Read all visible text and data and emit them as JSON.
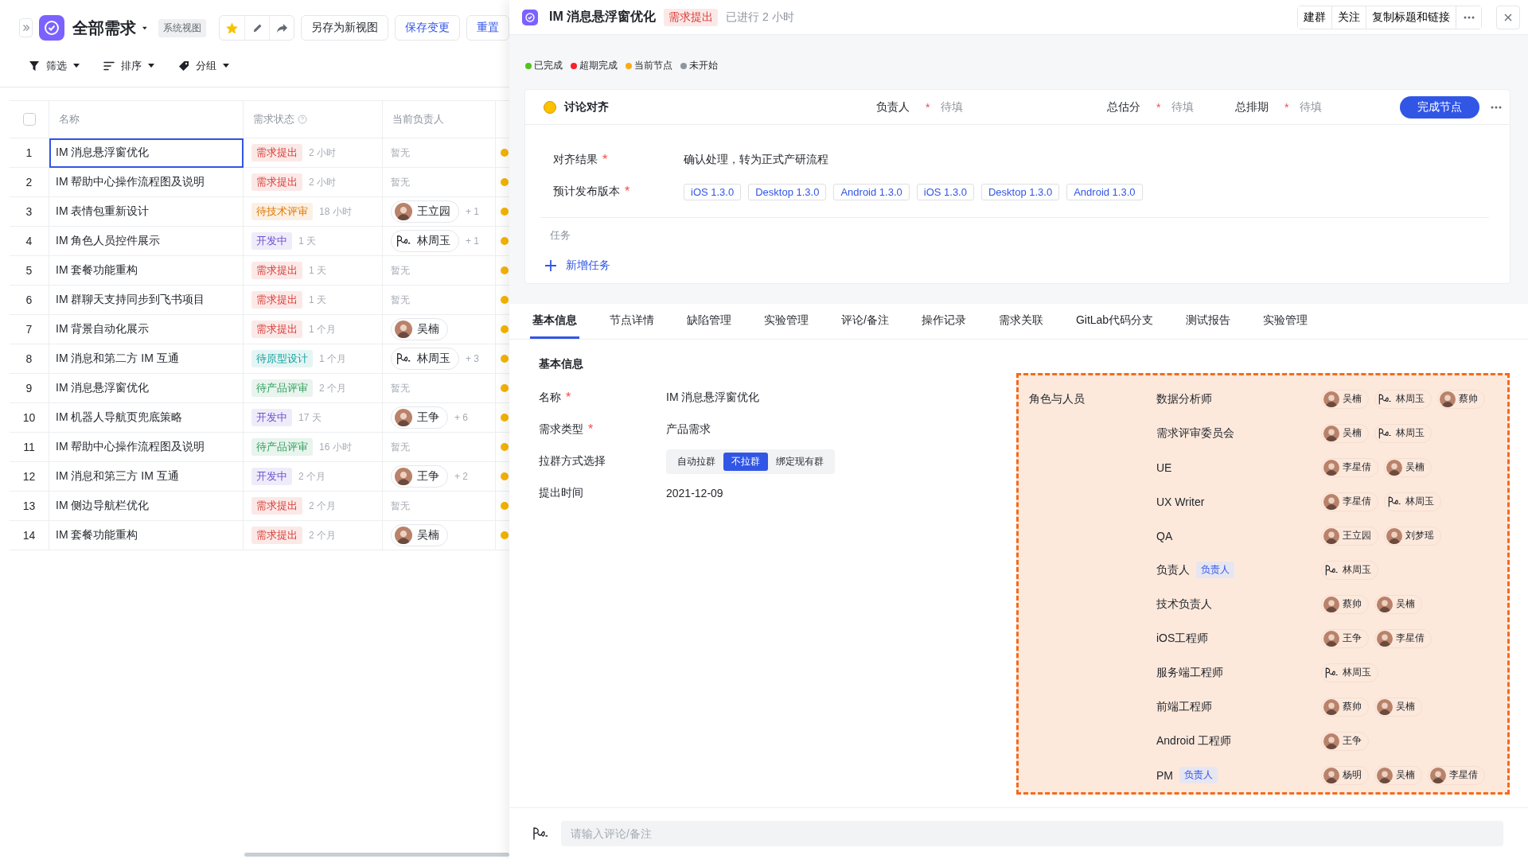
{
  "view": {
    "title": "全部需求",
    "badge": "系统视图",
    "starred": true,
    "actions": [
      {
        "label": "另存为新视图",
        "primary": false
      },
      {
        "label": "保存变更",
        "primary": true
      },
      {
        "label": "重置",
        "primary": true
      }
    ]
  },
  "toolbar": [
    {
      "kind": "filter",
      "label": "筛选"
    },
    {
      "kind": "sort",
      "label": "排序"
    },
    {
      "kind": "group",
      "label": "分组"
    }
  ],
  "table": {
    "select_all_checked": false,
    "columns": [
      "名称",
      "需求状态",
      "当前负责人"
    ],
    "rows": [
      {
        "index": "1",
        "name": "IM 消息悬浮窗优化",
        "selected": true,
        "status": {
          "label": "需求提出",
          "color": "#d83931"
        },
        "age": "2 小时",
        "owner_empty": "暂无"
      },
      {
        "index": "2",
        "name": "IM 帮助中心操作流程图及说明",
        "selected": false,
        "status": {
          "label": "需求提出",
          "color": "#d83931"
        },
        "age": "2 小时",
        "owner_empty": "暂无"
      },
      {
        "index": "3",
        "name": "IM 表情包重新设计",
        "selected": false,
        "status": {
          "label": "待技术评审",
          "color": "#de7802"
        },
        "age": "18 小时",
        "owner": {
          "name": "王立园",
          "kind": "photo"
        },
        "extra": "+ 1"
      },
      {
        "index": "4",
        "name": "IM 角色人员控件展示",
        "selected": false,
        "status": {
          "label": "开发中",
          "color": "#6e4fcf"
        },
        "age": "1 天",
        "owner": {
          "name": "林周玉",
          "kind": "sketch"
        },
        "extra": "+ 1"
      },
      {
        "index": "5",
        "name": "IM 套餐功能重构",
        "selected": false,
        "status": {
          "label": "需求提出",
          "color": "#d83931"
        },
        "age": "1 天",
        "owner_empty": "暂无"
      },
      {
        "index": "6",
        "name": "IM 群聊天支持同步到飞书项目",
        "selected": false,
        "status": {
          "label": "需求提出",
          "color": "#d83931"
        },
        "age": "1 天",
        "owner_empty": "暂无"
      },
      {
        "index": "7",
        "name": "IM 背景自动化展示",
        "selected": false,
        "status": {
          "label": "需求提出",
          "color": "#d83931"
        },
        "age": "1 个月",
        "owner": {
          "name": "吴楠",
          "kind": "photo"
        }
      },
      {
        "index": "8",
        "name": "IM 消息和第二方 IM 互通",
        "selected": false,
        "status": {
          "label": "待原型设计",
          "color": "#12a19a"
        },
        "age": "1 个月",
        "owner": {
          "name": "林周玉",
          "kind": "sketch"
        },
        "extra": "+ 3"
      },
      {
        "index": "9",
        "name": "IM 消息悬浮窗优化",
        "selected": false,
        "status": {
          "label": "待产品评审",
          "color": "#2e9f5a"
        },
        "age": "2 个月",
        "owner_empty": "暂无"
      },
      {
        "index": "10",
        "name": "IM 机器人导航页兜底策略",
        "selected": false,
        "status": {
          "label": "开发中",
          "color": "#6e4fcf"
        },
        "age": "17 天",
        "owner": {
          "name": "王争",
          "kind": "photo"
        },
        "extra": "+ 6"
      },
      {
        "index": "11",
        "name": "IM 帮助中心操作流程图及说明",
        "selected": false,
        "status": {
          "label": "待产品评审",
          "color": "#2e9f5a"
        },
        "age": "16 小时",
        "owner_empty": "暂无"
      },
      {
        "index": "12",
        "name": "IM 消息和第三方 IM 互通",
        "selected": false,
        "status": {
          "label": "开发中",
          "color": "#6e4fcf"
        },
        "age": "2 个月",
        "owner": {
          "name": "王争",
          "kind": "photo"
        },
        "extra": "+ 2"
      },
      {
        "index": "13",
        "name": "IM 侧边导航栏优化",
        "selected": false,
        "status": {
          "label": "需求提出",
          "color": "#d83931"
        },
        "age": "2 个月",
        "owner_empty": "暂无"
      },
      {
        "index": "14",
        "name": "IM 套餐功能重构",
        "selected": false,
        "status": {
          "label": "需求提出",
          "color": "#d83931"
        },
        "age": "2 个月",
        "owner": {
          "name": "吴楠",
          "kind": "photo"
        }
      }
    ]
  },
  "detail": {
    "title": "IM 消息悬浮窗优化",
    "status": {
      "label": "需求提出",
      "color": "#d83931"
    },
    "elapsed": "已进行 2 小时",
    "actions": [
      "建群",
      "关注",
      "复制标题和链接"
    ]
  },
  "legend": [
    {
      "label": "已完成",
      "color": "#52c41a"
    },
    {
      "label": "超期完成",
      "color": "#f5222d"
    },
    {
      "label": "当前节点",
      "color": "#faad14"
    },
    {
      "label": "未开始",
      "color": "#8f959e"
    }
  ],
  "node": {
    "name": "讨论对齐",
    "color": "#fdc100",
    "fields": [
      {
        "label": "负责人",
        "required_mark": "*",
        "placeholder": "待填"
      },
      {
        "label": "总估分",
        "required_mark": "*",
        "placeholder": "待填"
      },
      {
        "label": "总排期",
        "required_mark": "*",
        "placeholder": "待填"
      }
    ],
    "button": "完成节点",
    "result": {
      "label": "对齐结果",
      "required_mark": "*",
      "value": "确认处理，转为正式产研流程"
    },
    "versions": {
      "label": "预计发布版本",
      "required_mark": "*",
      "tags": [
        "iOS 1.3.0",
        "Desktop 1.3.0",
        "Android 1.3.0",
        "iOS 1.3.0",
        "Desktop 1.3.0",
        "Android 1.3.0"
      ]
    },
    "tasks_label": "任务",
    "add_task": "新增任务"
  },
  "tabs": [
    {
      "label": "基本信息",
      "selected": true
    },
    {
      "label": "节点详情",
      "selected": false
    },
    {
      "label": "缺陷管理",
      "selected": false
    },
    {
      "label": "实验管理",
      "selected": false
    },
    {
      "label": "评论/备注",
      "selected": false
    },
    {
      "label": "操作记录",
      "selected": false
    },
    {
      "label": "需求关联",
      "selected": false
    },
    {
      "label": "GitLab代码分支",
      "selected": false
    },
    {
      "label": "测试报告",
      "selected": false
    },
    {
      "label": "实验管理",
      "selected": false
    }
  ],
  "basic_info": {
    "title": "基本信息",
    "fields": [
      {
        "kind": "text",
        "label": "名称",
        "required_mark": "*",
        "value": "IM 消息悬浮窗优化"
      },
      {
        "kind": "text",
        "label": "需求类型",
        "required_mark": "*",
        "value": "产品需求"
      },
      {
        "kind": "segmented",
        "label": "拉群方式选择",
        "options": [
          {
            "label": "自动拉群",
            "selected": false
          },
          {
            "label": "不拉群",
            "selected": true
          },
          {
            "label": "绑定现有群",
            "selected": false
          }
        ]
      },
      {
        "kind": "text",
        "label": "提出时间",
        "value": "2021-12-09"
      }
    ]
  },
  "roles": {
    "title": "角色与人员",
    "highlighted": true,
    "rows": [
      {
        "role": "数据分析师",
        "people": [
          {
            "name": "吴楠",
            "kind": "photo"
          },
          {
            "name": "林周玉",
            "kind": "sketch"
          },
          {
            "name": "蔡帅",
            "kind": "photo"
          }
        ]
      },
      {
        "role": "需求评审委员会",
        "people": [
          {
            "name": "吴楠",
            "kind": "photo"
          },
          {
            "name": "林周玉",
            "kind": "sketch"
          }
        ]
      },
      {
        "role": "UE",
        "people": [
          {
            "name": "李星倩",
            "kind": "photo"
          },
          {
            "name": "吴楠",
            "kind": "photo"
          }
        ]
      },
      {
        "role": "UX Writer",
        "people": [
          {
            "name": "李星倩",
            "kind": "photo"
          },
          {
            "name": "林周玉",
            "kind": "sketch"
          }
        ]
      },
      {
        "role": "QA",
        "people": [
          {
            "name": "王立园",
            "kind": "photo"
          },
          {
            "name": "刘梦瑶",
            "kind": "photo"
          }
        ]
      },
      {
        "role": "负责人",
        "tag": "负责人",
        "people": [
          {
            "name": "林周玉",
            "kind": "sketch"
          }
        ]
      },
      {
        "role": "技术负责人",
        "people": [
          {
            "name": "蔡帅",
            "kind": "photo"
          },
          {
            "name": "吴楠",
            "kind": "photo"
          }
        ]
      },
      {
        "role": "iOS工程师",
        "people": [
          {
            "name": "王争",
            "kind": "photo"
          },
          {
            "name": "李星倩",
            "kind": "photo"
          }
        ]
      },
      {
        "role": "服务端工程师",
        "people": [
          {
            "name": "林周玉",
            "kind": "sketch"
          }
        ]
      },
      {
        "role": "前端工程师",
        "people": [
          {
            "name": "蔡帅",
            "kind": "photo"
          },
          {
            "name": "吴楠",
            "kind": "photo"
          }
        ]
      },
      {
        "role": "Android 工程师",
        "people": [
          {
            "name": "王争",
            "kind": "photo"
          }
        ]
      },
      {
        "role": "PM",
        "tag": "负责人",
        "people": [
          {
            "name": "杨明",
            "kind": "photo"
          },
          {
            "name": "吴楠",
            "kind": "photo"
          },
          {
            "name": "李星倩",
            "kind": "photo"
          }
        ]
      }
    ]
  },
  "comment": {
    "placeholder": "请输入评论/备注"
  }
}
